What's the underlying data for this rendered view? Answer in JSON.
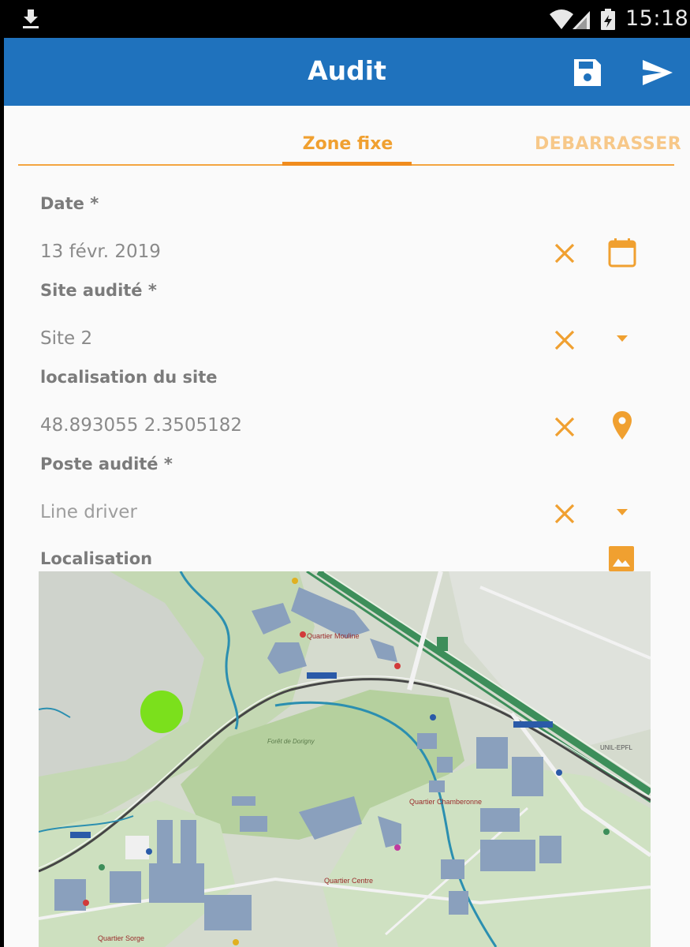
{
  "status_bar": {
    "time": "15:18",
    "icons": [
      "download-icon",
      "wifi-icon",
      "signal-icon",
      "battery-icon"
    ]
  },
  "app_bar": {
    "title": "Audit",
    "actions": [
      "save-icon",
      "send-icon"
    ]
  },
  "tabs": [
    {
      "label": "Zone fixe",
      "selected": true
    },
    {
      "label": "DEBARRASSER",
      "selected": false
    }
  ],
  "form": {
    "date": {
      "label": "Date *",
      "value": "13 févr. 2019",
      "action_icon": "calendar-icon"
    },
    "site": {
      "label": "Site audité *",
      "value": "Site 2",
      "action_icon": "dropdown-arrow-icon"
    },
    "location": {
      "label": "localisation du site",
      "value": "48.893055 2.3505182",
      "action_icon": "location-pin-icon"
    },
    "poste": {
      "label": "Poste audité *",
      "value": "Line driver",
      "action_icon": "dropdown-arrow-icon"
    },
    "localisation": {
      "label": "Localisation",
      "action_icon": "image-icon"
    }
  },
  "map_labels": {
    "quartier_mouline": "Quartier Mouline",
    "foret": "Forêt de Dorigny",
    "quartier_chamberonne": "Quartier Chamberonne",
    "quartier_centre": "Quartier Centre",
    "quartier_sorge": "Quartier Sorge",
    "unil_epfl": "UNIL-EPFL"
  },
  "colors": {
    "primary": "#1f72bd",
    "accent": "#f08c1e",
    "marker": "#7be01c"
  }
}
